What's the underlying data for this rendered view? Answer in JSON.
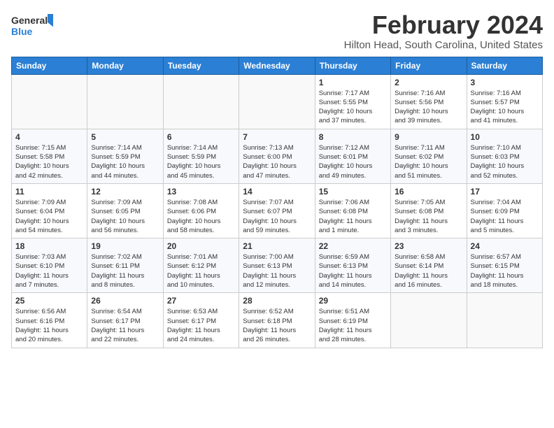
{
  "logo": {
    "line1": "General",
    "line2": "Blue"
  },
  "title": "February 2024",
  "location": "Hilton Head, South Carolina, United States",
  "weekdays": [
    "Sunday",
    "Monday",
    "Tuesday",
    "Wednesday",
    "Thursday",
    "Friday",
    "Saturday"
  ],
  "weeks": [
    [
      {
        "day": "",
        "info": ""
      },
      {
        "day": "",
        "info": ""
      },
      {
        "day": "",
        "info": ""
      },
      {
        "day": "",
        "info": ""
      },
      {
        "day": "1",
        "info": "Sunrise: 7:17 AM\nSunset: 5:55 PM\nDaylight: 10 hours\nand 37 minutes."
      },
      {
        "day": "2",
        "info": "Sunrise: 7:16 AM\nSunset: 5:56 PM\nDaylight: 10 hours\nand 39 minutes."
      },
      {
        "day": "3",
        "info": "Sunrise: 7:16 AM\nSunset: 5:57 PM\nDaylight: 10 hours\nand 41 minutes."
      }
    ],
    [
      {
        "day": "4",
        "info": "Sunrise: 7:15 AM\nSunset: 5:58 PM\nDaylight: 10 hours\nand 42 minutes."
      },
      {
        "day": "5",
        "info": "Sunrise: 7:14 AM\nSunset: 5:59 PM\nDaylight: 10 hours\nand 44 minutes."
      },
      {
        "day": "6",
        "info": "Sunrise: 7:14 AM\nSunset: 5:59 PM\nDaylight: 10 hours\nand 45 minutes."
      },
      {
        "day": "7",
        "info": "Sunrise: 7:13 AM\nSunset: 6:00 PM\nDaylight: 10 hours\nand 47 minutes."
      },
      {
        "day": "8",
        "info": "Sunrise: 7:12 AM\nSunset: 6:01 PM\nDaylight: 10 hours\nand 49 minutes."
      },
      {
        "day": "9",
        "info": "Sunrise: 7:11 AM\nSunset: 6:02 PM\nDaylight: 10 hours\nand 51 minutes."
      },
      {
        "day": "10",
        "info": "Sunrise: 7:10 AM\nSunset: 6:03 PM\nDaylight: 10 hours\nand 52 minutes."
      }
    ],
    [
      {
        "day": "11",
        "info": "Sunrise: 7:09 AM\nSunset: 6:04 PM\nDaylight: 10 hours\nand 54 minutes."
      },
      {
        "day": "12",
        "info": "Sunrise: 7:09 AM\nSunset: 6:05 PM\nDaylight: 10 hours\nand 56 minutes."
      },
      {
        "day": "13",
        "info": "Sunrise: 7:08 AM\nSunset: 6:06 PM\nDaylight: 10 hours\nand 58 minutes."
      },
      {
        "day": "14",
        "info": "Sunrise: 7:07 AM\nSunset: 6:07 PM\nDaylight: 10 hours\nand 59 minutes."
      },
      {
        "day": "15",
        "info": "Sunrise: 7:06 AM\nSunset: 6:08 PM\nDaylight: 11 hours\nand 1 minute."
      },
      {
        "day": "16",
        "info": "Sunrise: 7:05 AM\nSunset: 6:08 PM\nDaylight: 11 hours\nand 3 minutes."
      },
      {
        "day": "17",
        "info": "Sunrise: 7:04 AM\nSunset: 6:09 PM\nDaylight: 11 hours\nand 5 minutes."
      }
    ],
    [
      {
        "day": "18",
        "info": "Sunrise: 7:03 AM\nSunset: 6:10 PM\nDaylight: 11 hours\nand 7 minutes."
      },
      {
        "day": "19",
        "info": "Sunrise: 7:02 AM\nSunset: 6:11 PM\nDaylight: 11 hours\nand 8 minutes."
      },
      {
        "day": "20",
        "info": "Sunrise: 7:01 AM\nSunset: 6:12 PM\nDaylight: 11 hours\nand 10 minutes."
      },
      {
        "day": "21",
        "info": "Sunrise: 7:00 AM\nSunset: 6:13 PM\nDaylight: 11 hours\nand 12 minutes."
      },
      {
        "day": "22",
        "info": "Sunrise: 6:59 AM\nSunset: 6:13 PM\nDaylight: 11 hours\nand 14 minutes."
      },
      {
        "day": "23",
        "info": "Sunrise: 6:58 AM\nSunset: 6:14 PM\nDaylight: 11 hours\nand 16 minutes."
      },
      {
        "day": "24",
        "info": "Sunrise: 6:57 AM\nSunset: 6:15 PM\nDaylight: 11 hours\nand 18 minutes."
      }
    ],
    [
      {
        "day": "25",
        "info": "Sunrise: 6:56 AM\nSunset: 6:16 PM\nDaylight: 11 hours\nand 20 minutes."
      },
      {
        "day": "26",
        "info": "Sunrise: 6:54 AM\nSunset: 6:17 PM\nDaylight: 11 hours\nand 22 minutes."
      },
      {
        "day": "27",
        "info": "Sunrise: 6:53 AM\nSunset: 6:17 PM\nDaylight: 11 hours\nand 24 minutes."
      },
      {
        "day": "28",
        "info": "Sunrise: 6:52 AM\nSunset: 6:18 PM\nDaylight: 11 hours\nand 26 minutes."
      },
      {
        "day": "29",
        "info": "Sunrise: 6:51 AM\nSunset: 6:19 PM\nDaylight: 11 hours\nand 28 minutes."
      },
      {
        "day": "",
        "info": ""
      },
      {
        "day": "",
        "info": ""
      }
    ]
  ]
}
